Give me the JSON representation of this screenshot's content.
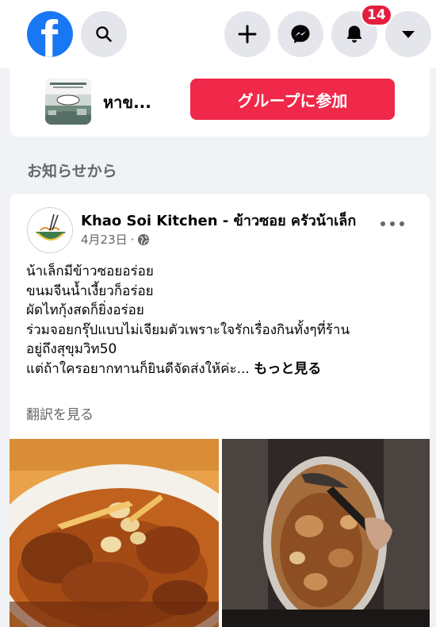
{
  "topbar": {
    "logo_letter": "f",
    "notification_count": "14",
    "colors": {
      "brand": "#1877f2",
      "badge": "#e41e3f"
    },
    "icons": [
      "facebook-logo-icon",
      "search-icon",
      "plus-icon",
      "messenger-icon",
      "bell-icon",
      "caret-down-icon"
    ]
  },
  "group_card": {
    "name": "หาข...",
    "join_label": "グループに参加",
    "join_color": "#f02849"
  },
  "section": {
    "label": "お知らせから"
  },
  "post": {
    "author": "Khao Soi Kitchen - ข้าวซอย ครัวน้าเล็ก",
    "date": "4月23日",
    "separator": "·",
    "audience_icon": "globe-icon",
    "lines": [
      "น้าเล็กมีข้าวซอยอร่อย",
      "ขนมจีนน้ำเงี้ยวก็อร่อย",
      "ผัดไทกุ้งสดก็ยิ่งอร่อย",
      "ร่วมจอยกรุ๊ปแบบไม่เจียมตัวเพราะใจรักเรื่องกินทั้งๆที่ร้าน",
      "อยู่ถึงสุขุมวิท50",
      "แต่ถ้าใครอยากทานก็ยินดีจัดส่งให้ค่ะ..."
    ],
    "see_more": "もっと見る",
    "translate": "翻訳を見る"
  }
}
